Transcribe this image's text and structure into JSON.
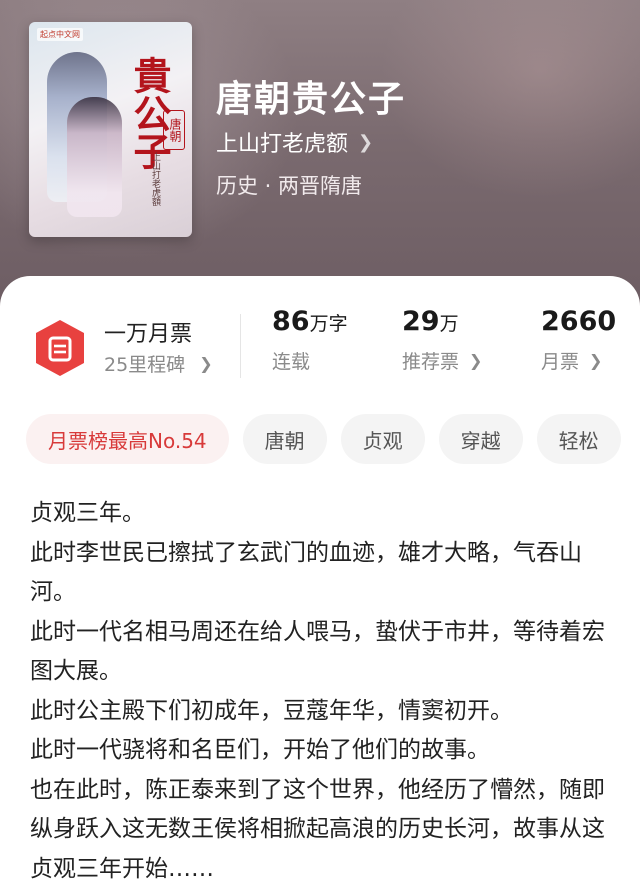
{
  "colors": {
    "accent": "#e8413f",
    "header_bg": "#7a6a6f",
    "tag_bg": "#f4f4f4",
    "tag_hot_text": "#d83a3a"
  },
  "book": {
    "title": "唐朝贵公子",
    "author": "上山打老虎额",
    "category": "历史 · 两晋隋唐",
    "cover": {
      "brand": "起点中文网",
      "title": "貴公子",
      "seal": "唐朝",
      "author": "上山打老虎額"
    }
  },
  "stats": {
    "monthly_ticket": {
      "icon": "ticket-icon",
      "title": "一万月票",
      "milestone": "25里程碑"
    },
    "items": [
      {
        "num": "86",
        "unit": "万字",
        "label": "连载",
        "has_chevron": false
      },
      {
        "num": "29",
        "unit": "万",
        "label": "推荐票",
        "has_chevron": true
      },
      {
        "num": "2660",
        "unit": "",
        "label": "月票",
        "has_chevron": true
      }
    ]
  },
  "tags": [
    "月票榜最高No.54",
    "唐朝",
    "贞观",
    "穿越",
    "轻松"
  ],
  "synopsis": [
    "贞观三年。",
    "此时李世民已擦拭了玄武门的血迹，雄才大略，气吞山河。",
    "此时一代名相马周还在给人喂马，蛰伏于市井，等待着宏图大展。",
    "此时公主殿下们初成年，豆蔻年华，情窦初开。",
    "此时一代骁将和名臣们，开始了他们的故事。",
    "也在此时，陈正泰来到了这个世界，他经历了懵然，随即纵身跃入这无数王侯将相掀起高浪的历史长河，故事从这贞观三年开始……"
  ]
}
